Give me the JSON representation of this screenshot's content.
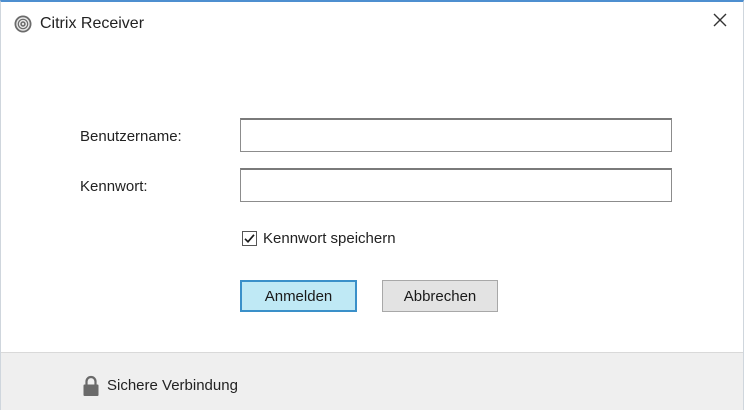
{
  "window": {
    "title": "Citrix Receiver",
    "app_icon": "citrix-logo-icon",
    "close_icon": "close-icon",
    "accent_color": "#4d8fd0"
  },
  "form": {
    "username_label": "Benutzername:",
    "username_value": "",
    "password_label": "Kennwort:",
    "password_value": "",
    "remember_label": "Kennwort speichern",
    "remember_checked": true
  },
  "buttons": {
    "login_label": "Anmelden",
    "cancel_label": "Abbrechen",
    "login_color": "#bfe9f5"
  },
  "footer": {
    "lock_icon": "lock-icon",
    "status_text": "Sichere Verbindung"
  }
}
